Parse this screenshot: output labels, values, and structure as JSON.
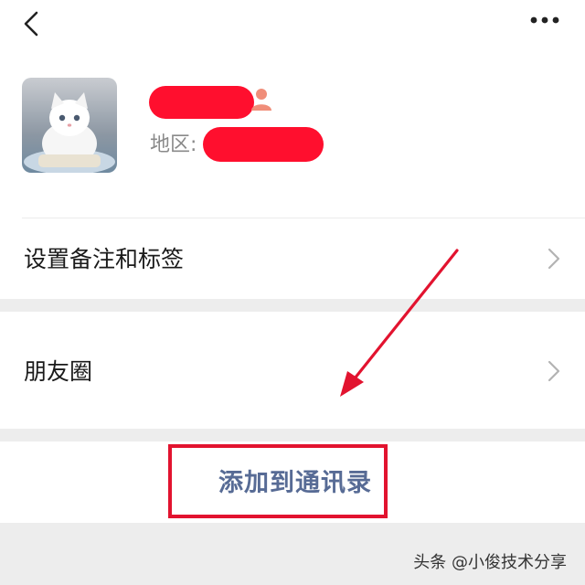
{
  "header": {
    "back_icon": "chevron-left-icon",
    "more_icon": "more-horizontal-icon"
  },
  "profile": {
    "avatar": "white-kitten-photo",
    "name": "",
    "region_label": "地区:",
    "region_value": "",
    "redaction_color": "#ff0f2e"
  },
  "rows": [
    {
      "label": "设置备注和标签"
    },
    {
      "label": "朋友圈"
    }
  ],
  "add_contact": {
    "label": "添加到通讯录",
    "color": "#576b95"
  },
  "annotation": {
    "color": "#e2132f"
  },
  "watermark": {
    "text": "头条 @小俊技术分享"
  }
}
